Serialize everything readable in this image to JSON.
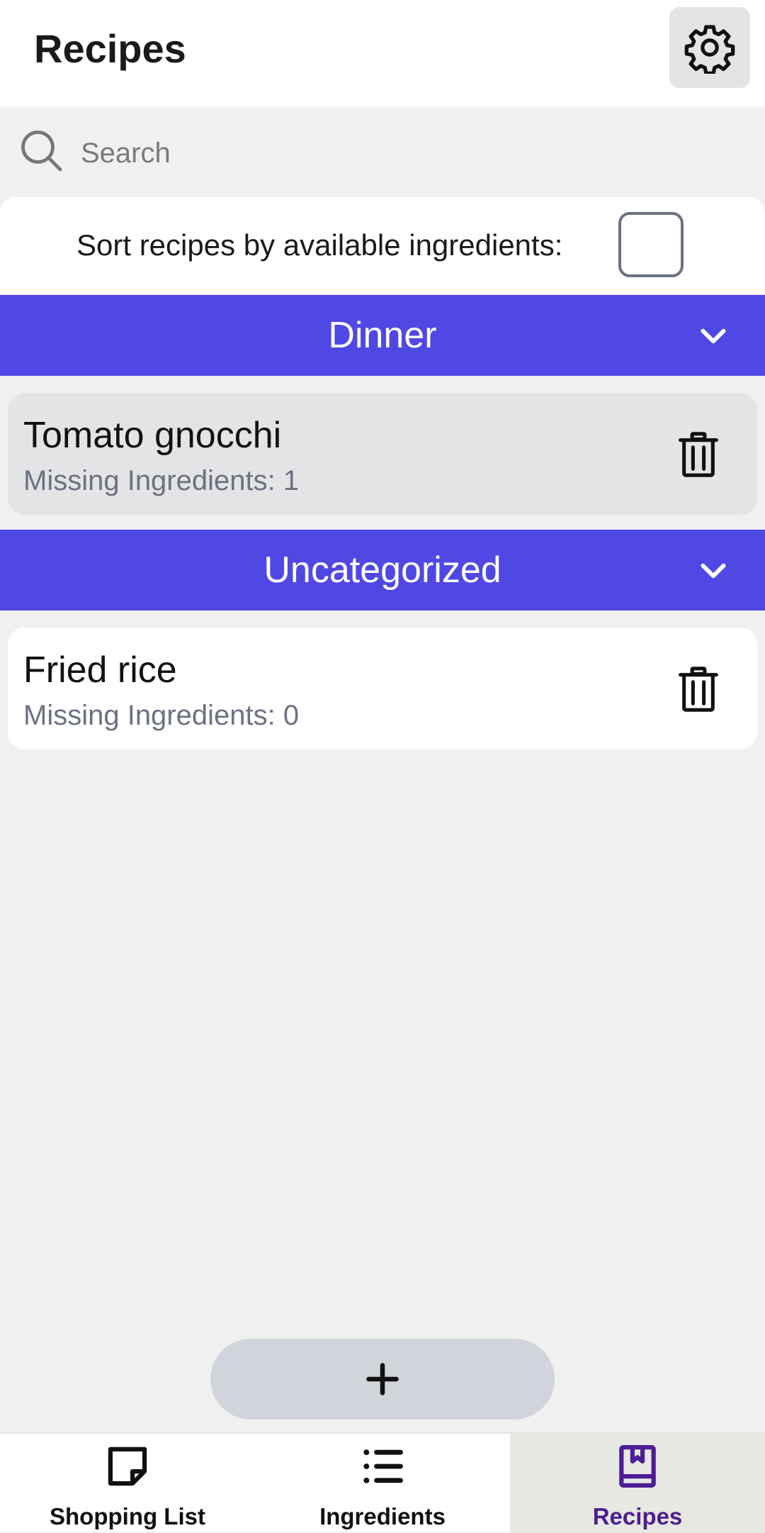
{
  "header": {
    "title": "Recipes",
    "settings_icon": "gear-icon"
  },
  "search": {
    "placeholder": "Search",
    "value": ""
  },
  "sort": {
    "label": "Sort recipes by available ingredients:",
    "checked": false
  },
  "sections": [
    {
      "title": "Dinner",
      "expanded": true,
      "recipes": [
        {
          "name": "Tomato gnocchi",
          "missing": "Missing Ingredients: 1",
          "highlighted": true
        }
      ]
    },
    {
      "title": "Uncategorized",
      "expanded": true,
      "recipes": [
        {
          "name": "Fried rice",
          "missing": "Missing Ingredients: 0",
          "highlighted": false
        }
      ]
    }
  ],
  "add_button": {
    "icon": "plus-icon"
  },
  "nav": {
    "items": [
      {
        "label": "Shopping List",
        "icon": "note-icon",
        "active": false
      },
      {
        "label": "Ingredients",
        "icon": "list-icon",
        "active": false
      },
      {
        "label": "Recipes",
        "icon": "book-icon",
        "active": true
      }
    ]
  },
  "colors": {
    "section_header": "#5048e5",
    "active_nav_label": "#4c1d95",
    "highlighted_card": "#e4e4e7",
    "card": "#ffffff",
    "background": "#f0f0f1"
  }
}
